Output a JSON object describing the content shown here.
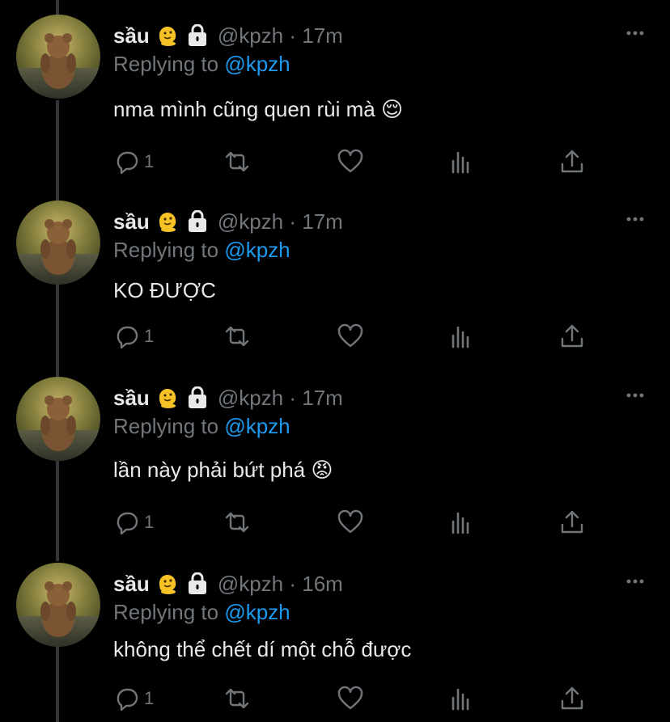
{
  "colors": {
    "background": "#000000",
    "text": "#e7e9ea",
    "muted": "#71767b",
    "link": "#1d9bf0",
    "thread_line": "#333639"
  },
  "tweets": [
    {
      "name": "sầu",
      "handle": "@kpzh · 17m",
      "reply_prefix": "Replying to",
      "reply_mention": "@kpzh",
      "text": "nma mình cũng quen rùi mà",
      "text_emoji": "😌",
      "reply_count": "1",
      "icons": [
        "melting-face-emoji",
        "lock-icon",
        "more-icon",
        "reply-icon",
        "retweet-icon",
        "like-icon",
        "views-icon",
        "share-icon"
      ]
    },
    {
      "name": "sầu",
      "handle": "@kpzh · 17m",
      "reply_prefix": "Replying to",
      "reply_mention": "@kpzh",
      "text": "KO ĐƯỢC",
      "text_emoji": "",
      "reply_count": "1"
    },
    {
      "name": "sầu",
      "handle": "@kpzh · 17m",
      "reply_prefix": "Replying to",
      "reply_mention": "@kpzh",
      "text": "lần này phải bứt phá",
      "text_emoji": "😡",
      "reply_count": "1"
    },
    {
      "name": "sầu",
      "handle": "@kpzh · 16m",
      "reply_prefix": "Replying to",
      "reply_mention": "@kpzh",
      "text": "không thể chết dí một chỗ được",
      "text_emoji": "",
      "reply_count": "1"
    }
  ]
}
